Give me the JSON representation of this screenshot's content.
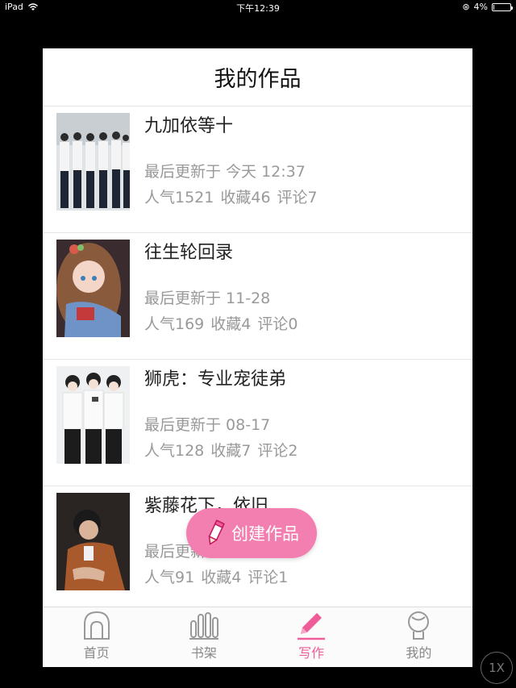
{
  "status_bar": {
    "device": "iPad",
    "time": "下午12:39",
    "battery": "4%",
    "battery_level": 0.04
  },
  "header": {
    "title": "我的作品"
  },
  "works": [
    {
      "title": "九加依等十",
      "updated": "最后更新于 今天 12:37",
      "popularity": "人气1521",
      "favorites": "收藏46",
      "comments": "评论7",
      "cover": "group-photo-cover"
    },
    {
      "title": "往生轮回录",
      "updated": "最后更新于 11-28",
      "popularity": "人气169",
      "favorites": "收藏4",
      "comments": "评论0",
      "cover": "anime-girl-cover"
    },
    {
      "title": "狮虎：专业宠徒弟",
      "updated": "最后更新于 08-17",
      "popularity": "人气128",
      "favorites": "收藏7",
      "comments": "评论2",
      "cover": "trio-photo-cover"
    },
    {
      "title": "紫藤花下，依旧",
      "updated": "最后更新于 ...",
      "popularity": "人气91",
      "favorites": "收藏4",
      "comments": "评论1",
      "cover": "portrait-cover"
    }
  ],
  "fab": {
    "label": "创建作品",
    "icon": "pencil-icon"
  },
  "tabs": [
    {
      "label": "首页",
      "icon": "home-icon"
    },
    {
      "label": "书架",
      "icon": "bookshelf-icon"
    },
    {
      "label": "写作",
      "icon": "write-icon",
      "active": true
    },
    {
      "label": "我的",
      "icon": "profile-icon"
    }
  ],
  "overlay": {
    "speed_label": "1X"
  },
  "colors": {
    "accent": "#ef5d98",
    "fab": "#f37fb1",
    "meta_text": "#999999"
  }
}
